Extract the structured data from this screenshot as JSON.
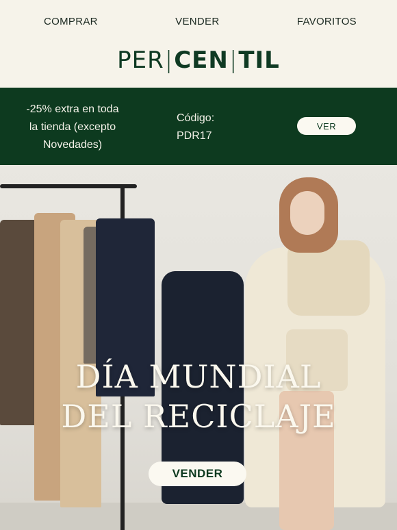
{
  "nav": {
    "items": [
      "COMPRAR",
      "VENDER",
      "FAVORITOS"
    ]
  },
  "logo": {
    "part1": "PER",
    "part2": "CEN",
    "part3": "TIL"
  },
  "promo": {
    "line1": "-25% extra en toda",
    "line2": "la tienda (excepto",
    "line3": "Novedades)",
    "code_label": "Código:",
    "code": "PDR17",
    "button": "VER"
  },
  "hero": {
    "title_line1": "DÍA MUNDIAL",
    "title_line2": "DEL RECICLAJE",
    "cta": "VENDER"
  },
  "colors": {
    "brand_green": "#0d3a1f",
    "cream": "#f6f3ea"
  }
}
